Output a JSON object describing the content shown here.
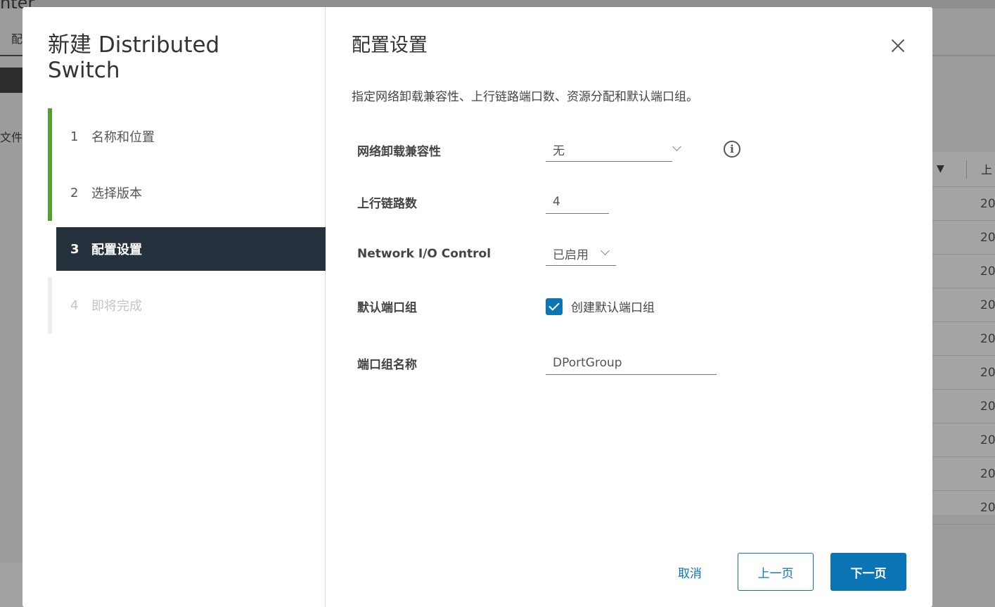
{
  "background": {
    "title_fragment": "nter",
    "tab_fragment": "配",
    "left_label": "文件",
    "table_rows": [
      "20",
      "20",
      "20",
      "20",
      "20",
      "20",
      "20",
      "20",
      "20",
      "20"
    ],
    "table_header_fragment": "上"
  },
  "wizard": {
    "title": "新建 Distributed Switch",
    "steps": [
      {
        "num": "1",
        "label": "名称和位置"
      },
      {
        "num": "2",
        "label": "选择版本"
      },
      {
        "num": "3",
        "label": "配置设置"
      },
      {
        "num": "4",
        "label": "即将完成"
      }
    ]
  },
  "content": {
    "title": "配置设置",
    "description": "指定网络卸载兼容性、上行链路端口数、资源分配和默认端口组。",
    "fields": {
      "offload": {
        "label": "网络卸载兼容性",
        "value": "无"
      },
      "uplinks": {
        "label": "上行链路数",
        "value": "4"
      },
      "nioc": {
        "label": "Network I/O Control",
        "value": "已启用"
      },
      "default_pg": {
        "label": "默认端口组",
        "checkbox_label": "创建默认端口组"
      },
      "pg_name": {
        "label": "端口组名称",
        "value": "DPortGroup"
      }
    },
    "info_glyph": "i"
  },
  "buttons": {
    "cancel": "取消",
    "prev": "上一页",
    "next": "下一页"
  },
  "colors": {
    "accent": "#0b74b5",
    "done_step": "#55a030",
    "current_step_bg": "#25323d"
  }
}
